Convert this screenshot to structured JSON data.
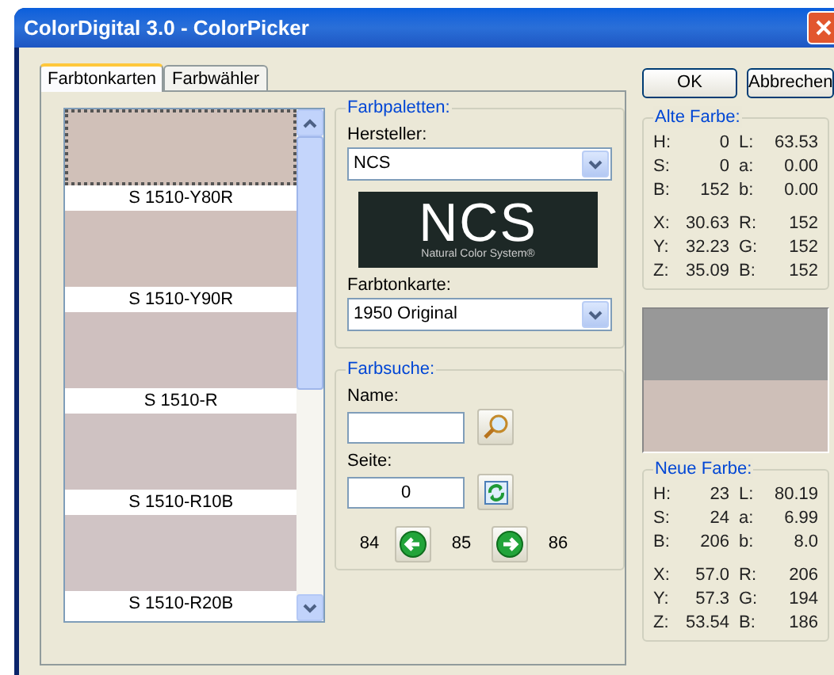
{
  "window": {
    "title": "ColorDigital 3.0 - ColorPicker"
  },
  "tabs": [
    {
      "label": "Farbtonkarten",
      "selected": true
    },
    {
      "label": "Farbwähler",
      "selected": false
    }
  ],
  "swatch_list": [
    {
      "name": "S 1510-Y80R",
      "color": "#d0c0b8",
      "selected": true
    },
    {
      "name": "S 1510-Y90R",
      "color": "#d0c0bb",
      "selected": false
    },
    {
      "name": "S 1510-R",
      "color": "#cfc0bf",
      "selected": false
    },
    {
      "name": "S 1510-R10B",
      "color": "#cfc2c2",
      "selected": false
    },
    {
      "name": "S 1510-R20B",
      "color": "#d0c4c5",
      "selected": false
    }
  ],
  "palettes": {
    "legend": "Farbpaletten:",
    "manufacturer_label": "Hersteller:",
    "manufacturer_value": "NCS",
    "logo": {
      "mark": "NCS",
      "tagline": "Natural Color System®"
    },
    "chart_label": "Farbtonkarte:",
    "chart_value": "1950 Original"
  },
  "search": {
    "legend": "Farbsuche:",
    "name_label": "Name:",
    "page_label": "Seite:",
    "page_value": "0",
    "pages": [
      "84",
      "85",
      "86"
    ]
  },
  "buttons": [
    "OK",
    "Abbrechen"
  ],
  "old_color": {
    "legend": "Alte Farbe:",
    "groups": [
      [
        {
          "label": "H:",
          "value": "0",
          "label2": "L:",
          "value2": "63.53"
        },
        {
          "label": "S:",
          "value": "0",
          "label2": "a:",
          "value2": "0.00"
        },
        {
          "label": "B:",
          "value": "152",
          "label2": "b:",
          "value2": "0.00"
        }
      ],
      [
        {
          "label": "X:",
          "value": "30.63",
          "label2": "R:",
          "value2": "152"
        },
        {
          "label": "Y:",
          "value": "32.23",
          "label2": "G:",
          "value2": "152"
        },
        {
          "label": "Z:",
          "value": "35.09",
          "label2": "B:",
          "value2": "152"
        }
      ]
    ]
  },
  "preview": [
    {
      "color": "#989898"
    },
    {
      "color": "#cebfb8"
    }
  ],
  "new_color": {
    "legend": "Neue Farbe:",
    "groups": [
      [
        {
          "label": "H:",
          "value": "23",
          "label2": "L:",
          "value2": "80.19"
        },
        {
          "label": "S:",
          "value": "24",
          "label2": "a:",
          "value2": "6.99"
        },
        {
          "label": "B:",
          "value": "206",
          "label2": "b:",
          "value2": "8.0"
        }
      ],
      [
        {
          "label": "X:",
          "value": "57.0",
          "label2": "R:",
          "value2": "206"
        },
        {
          "label": "Y:",
          "value": "57.3",
          "label2": "G:",
          "value2": "194"
        },
        {
          "label": "Z:",
          "value": "53.54",
          "label2": "B:",
          "value2": "186"
        }
      ]
    ]
  }
}
